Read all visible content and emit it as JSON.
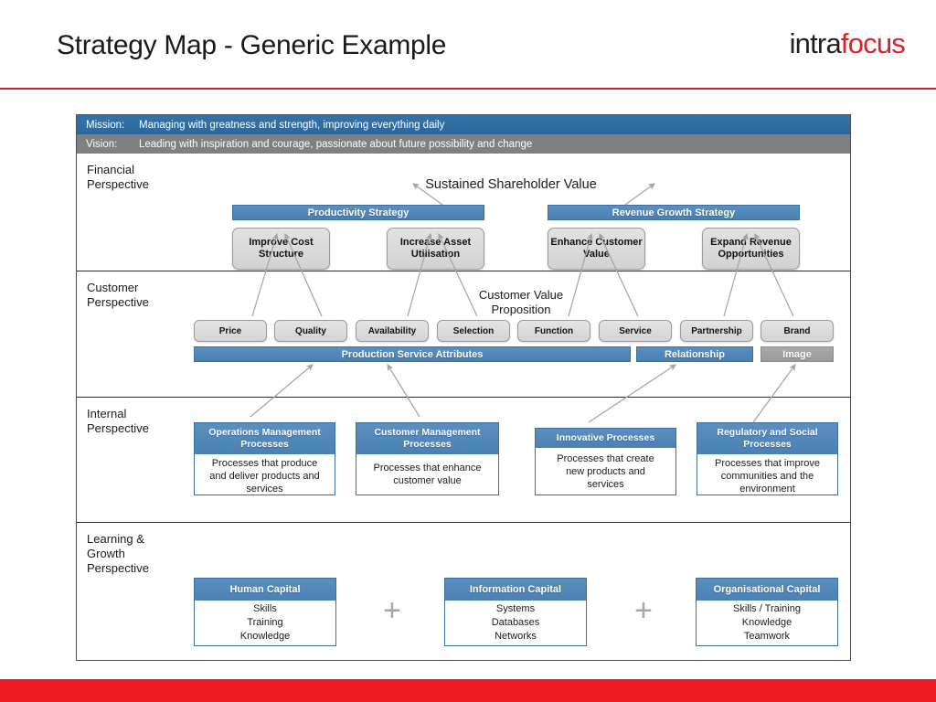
{
  "header": {
    "title": "Strategy Map - Generic Example",
    "logo_intra": "intra",
    "logo_focus": "focus",
    "rule_color": "#cf2030",
    "footer_color": "#ed1c24"
  },
  "banners": {
    "mission_label": "Mission:",
    "mission_text": "Managing with greatness and strength, improving everything daily",
    "mission_color": "#2e6da4",
    "vision_label": "Vision:",
    "vision_text": "Leading with inspiration and courage, passionate about future possibility and change",
    "vision_color": "#808080"
  },
  "perspectives": [
    {
      "key": "financial",
      "label": "Financial\nPerspective"
    },
    {
      "key": "customer",
      "label": "Customer\nPerspective"
    },
    {
      "key": "internal",
      "label": "Internal\nPerspective"
    },
    {
      "key": "learning",
      "label": "Learning &\nGrowth\nPerspective"
    }
  ],
  "financial": {
    "headline": "Sustained Shareholder Value",
    "strategy_bars": [
      {
        "label": "Productivity Strategy",
        "style": "blue"
      },
      {
        "label": "Revenue Growth Strategy",
        "style": "blue"
      }
    ],
    "objectives": [
      {
        "label": "Improve Cost\nStructure"
      },
      {
        "label": "Increase\nAsset\nUtilisation"
      },
      {
        "label": "Enhance\nCustomer\nValue"
      },
      {
        "label": "Expand\nRevenue\nOpportunities"
      }
    ]
  },
  "customer": {
    "headline": "Customer Value\nProposition",
    "attributes": [
      {
        "label": "Price"
      },
      {
        "label": "Quality"
      },
      {
        "label": "Availability"
      },
      {
        "label": "Selection"
      },
      {
        "label": "Function"
      },
      {
        "label": "Service"
      },
      {
        "label": "Partnership"
      },
      {
        "label": "Brand"
      }
    ],
    "group_bars": [
      {
        "label": "Production Service Attributes",
        "style": "blue",
        "spans": 6
      },
      {
        "label": "Relationship",
        "style": "blue",
        "spans": 1
      },
      {
        "label": "Image",
        "style": "gray",
        "spans": 1
      }
    ]
  },
  "internal": {
    "processes": [
      {
        "title": "Operations\nManagement Processes",
        "body": "Processes that produce\nand deliver products and\nservices"
      },
      {
        "title": "Customer Management\nProcesses",
        "body": "Processes that enhance\ncustomer value"
      },
      {
        "title": "Innovative Processes",
        "body": "Processes that create\nnew products and\nservices"
      },
      {
        "title": "Regulatory and Social\nProcesses",
        "body": "Processes that improve\ncommunities and the\nenvironment"
      }
    ]
  },
  "learning": {
    "capitals": [
      {
        "title": "Human Capital",
        "body": "Skills\nTraining\nKnowledge"
      },
      {
        "title": "Information Capital",
        "body": "Systems\nDatabases\nNetworks"
      },
      {
        "title": "Organisational Capital",
        "body": "Skills / Training\nKnowledge\nTeamwork"
      }
    ],
    "separators": [
      "+",
      "+"
    ]
  }
}
